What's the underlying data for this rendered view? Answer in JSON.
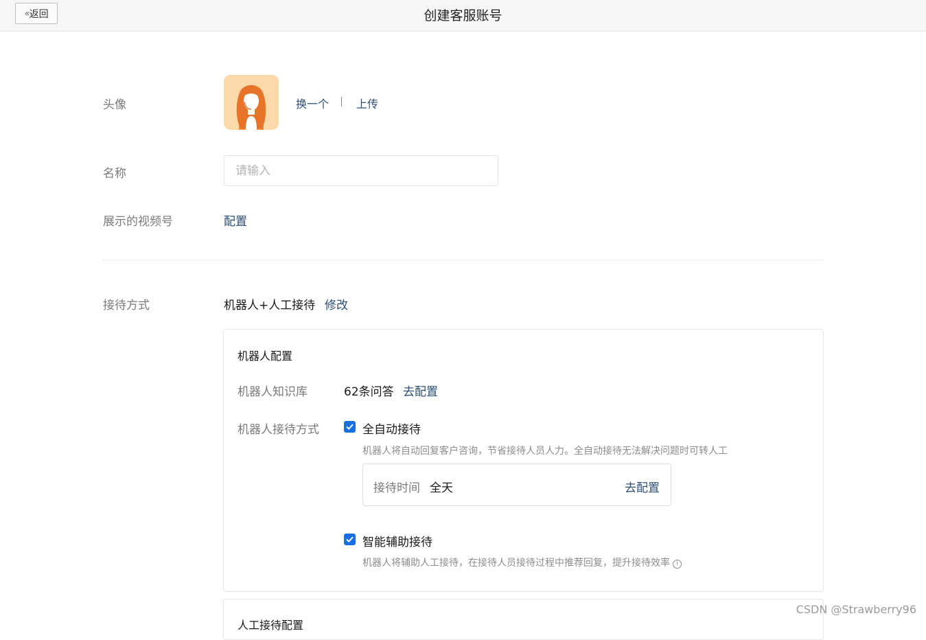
{
  "header": {
    "back_label": "返回",
    "title": "创建客服账号"
  },
  "avatar_row": {
    "label": "头像",
    "change_link": "换一个",
    "upload_link": "上传",
    "avatar_icon": "female-support-agent-avatar"
  },
  "name_row": {
    "label": "名称",
    "placeholder": "请输入",
    "value": ""
  },
  "video_row": {
    "label": "展示的视频号",
    "link": "配置"
  },
  "reception_row": {
    "label": "接待方式",
    "value": "机器人+人工接待",
    "modify_link": "修改"
  },
  "robot_config": {
    "title": "机器人配置",
    "knowledge_label": "机器人知识库",
    "knowledge_value": "62条问答",
    "knowledge_link": "去配置",
    "mode_label": "机器人接待方式",
    "auto": {
      "checked": true,
      "label": "全自动接待",
      "hint": "机器人将自动回复客户咨询，节省接待人员人力。全自动接待无法解决问题时可转人工",
      "time_label": "接待时间",
      "time_value": "全天",
      "time_link": "去配置"
    },
    "assist": {
      "checked": true,
      "label": "智能辅助接待",
      "hint": "机器人将辅助人工接待，在接待人员接待过程中推荐回复，提升接待效率"
    }
  },
  "manual_config": {
    "title": "人工接待配置"
  },
  "watermark": "CSDN @Strawberry96",
  "colors": {
    "link": "#2d4e73",
    "checkbox": "#1a6fe0",
    "label": "#7a7a7a"
  }
}
